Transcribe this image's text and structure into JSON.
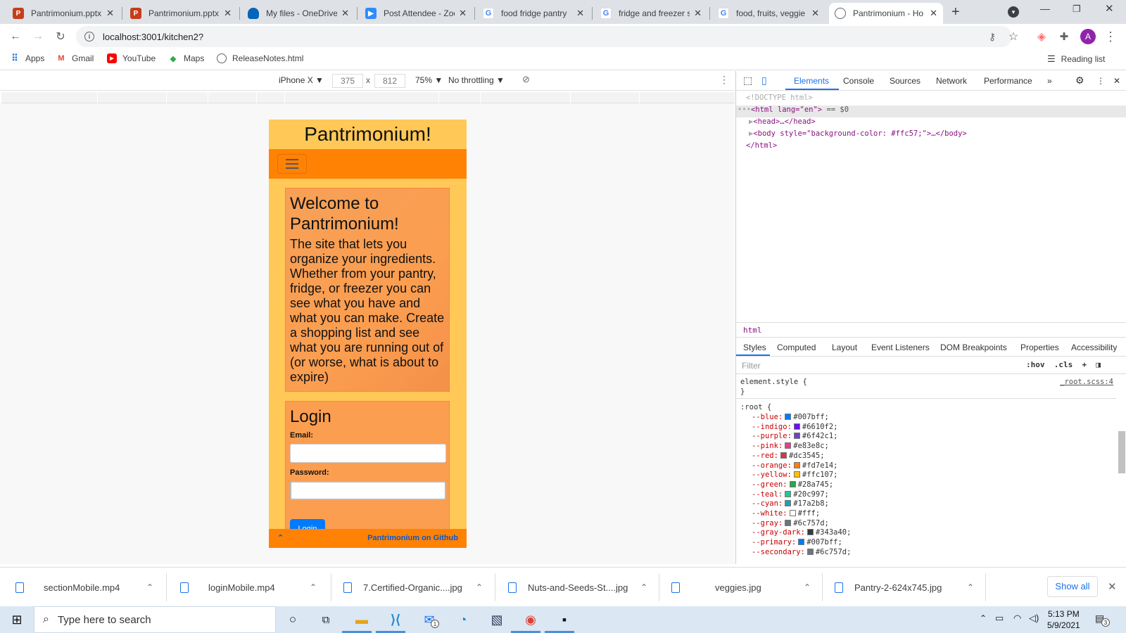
{
  "browser": {
    "tabs": [
      {
        "title": "Pantrimonium.pptx",
        "icon": "powerpoint-icon",
        "color": "#c43e1c"
      },
      {
        "title": "Pantrimonium.pptx",
        "icon": "powerpoint-icon",
        "color": "#c43e1c"
      },
      {
        "title": "My files - OneDrive",
        "icon": "onedrive-icon",
        "color": "#0364b8"
      },
      {
        "title": "Post Attendee - Zoo",
        "icon": "zoom-icon",
        "color": "#2d8cff"
      },
      {
        "title": "food fridge pantry",
        "icon": "google-icon",
        "color": "#4285f4"
      },
      {
        "title": "fridge and freezer s",
        "icon": "google-icon",
        "color": "#4285f4"
      },
      {
        "title": "food, fruits, veggie",
        "icon": "google-icon",
        "color": "#4285f4"
      },
      {
        "title": "Pantrimonium - Ho",
        "icon": "globe-icon",
        "color": "#5f6368"
      }
    ],
    "url": "localhost:3001/kitchen2?",
    "bookmarks": [
      {
        "label": "Apps",
        "icon": "apps-grid-icon"
      },
      {
        "label": "Gmail",
        "icon": "gmail-icon"
      },
      {
        "label": "YouTube",
        "icon": "youtube-icon"
      },
      {
        "label": "Maps",
        "icon": "maps-icon"
      },
      {
        "label": "ReleaseNotes.html",
        "icon": "globe-icon"
      }
    ],
    "reading_list": "Reading list",
    "profile_initial": "A"
  },
  "device_toolbar": {
    "device": "iPhone X",
    "width": "375",
    "height": "812",
    "zoom": "75%",
    "throttling": "No throttling"
  },
  "app": {
    "title": "Pantrimonium!",
    "welcome_heading": "Welcome to Pantrimonium!",
    "welcome_text": "The site that lets you organize your ingredients. Whether from your pantry, fridge, or freezer you can see what you have and what you can make. Create a shopping list and see what you are running out of (or worse, what is about to expire)",
    "login_heading": "Login",
    "email_label": "Email:",
    "password_label": "Password:",
    "login_button": "Login",
    "footer_link": "Pantrimonium on Github",
    "background": "#ffc857",
    "nav_color": "#ff8205"
  },
  "devtools": {
    "tabs": [
      "Elements",
      "Console",
      "Sources",
      "Network",
      "Performance"
    ],
    "dom": {
      "doctype": "<!DOCTYPE html>",
      "html_open": "<html lang=\"en\">",
      "html_suffix": "== $0",
      "head": "<head>…</head>",
      "body": "<body style=\"background-color: #ffc57;\">…</body>",
      "html_close": "</html>"
    },
    "breadcrumb": "html",
    "style_tabs": [
      "Styles",
      "Computed",
      "Layout",
      "Event Listeners",
      "DOM Breakpoints",
      "Properties",
      "Accessibility"
    ],
    "filter_placeholder": "Filter",
    "hov": ":hov",
    "cls": ".cls",
    "element_style": "element.style {",
    "close_brace": "}",
    "root_selector": ":root {",
    "root_source": "_root.scss:4",
    "variables": [
      {
        "name": "--blue:",
        "value": "#007bff;",
        "color": "#007bff"
      },
      {
        "name": "--indigo:",
        "value": "#6610f2;",
        "color": "#6610f2"
      },
      {
        "name": "--purple:",
        "value": "#6f42c1;",
        "color": "#6f42c1"
      },
      {
        "name": "--pink:",
        "value": "#e83e8c;",
        "color": "#e83e8c"
      },
      {
        "name": "--red:",
        "value": "#dc3545;",
        "color": "#dc3545"
      },
      {
        "name": "--orange:",
        "value": "#fd7e14;",
        "color": "#fd7e14"
      },
      {
        "name": "--yellow:",
        "value": "#ffc107;",
        "color": "#ffc107"
      },
      {
        "name": "--green:",
        "value": "#28a745;",
        "color": "#28a745"
      },
      {
        "name": "--teal:",
        "value": "#20c997;",
        "color": "#20c997"
      },
      {
        "name": "--cyan:",
        "value": "#17a2b8;",
        "color": "#17a2b8"
      },
      {
        "name": "--white:",
        "value": "#fff;",
        "color": "#ffffff"
      },
      {
        "name": "--gray:",
        "value": "#6c757d;",
        "color": "#6c757d"
      },
      {
        "name": "--gray-dark:",
        "value": "#343a40;",
        "color": "#343a40"
      },
      {
        "name": "--primary:",
        "value": "#007bff;",
        "color": "#007bff"
      },
      {
        "name": "--secondary:",
        "value": "#6c757d;",
        "color": "#6c757d"
      }
    ]
  },
  "downloads": {
    "items": [
      "sectionMobile.mp4",
      "loginMobile.mp4",
      "7.Certified-Organic....jpg",
      "Nuts-and-Seeds-St....jpg",
      "veggies.jpg",
      "Pantry-2-624x745.jpg"
    ],
    "show_all": "Show all"
  },
  "taskbar": {
    "search_placeholder": "Type here to search",
    "time": "5:13 PM",
    "date": "5/9/2021",
    "notifications": "3",
    "mail_badge": "1"
  }
}
